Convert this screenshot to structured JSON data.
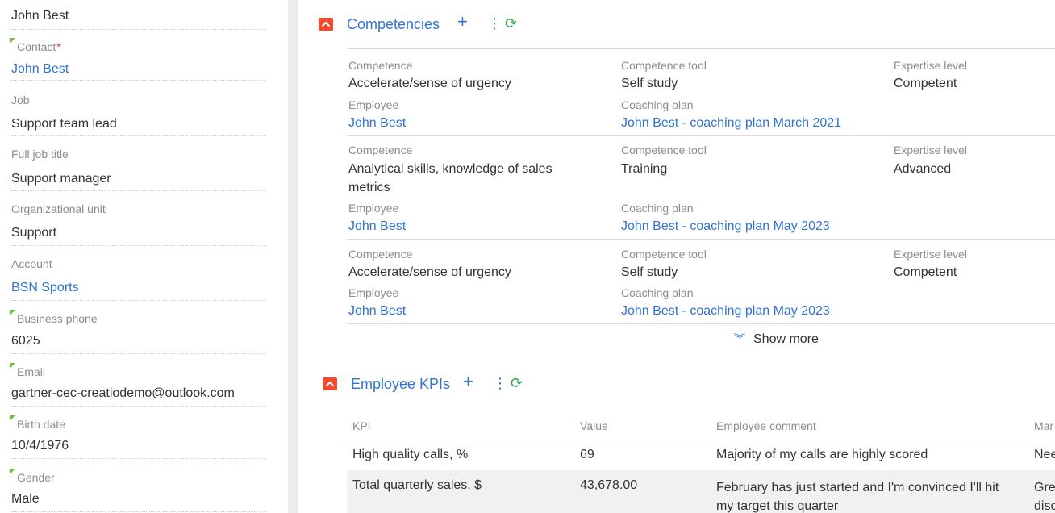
{
  "left_panel": {
    "top_value": "John Best",
    "fields": [
      {
        "label": "Contact",
        "required": "*",
        "value": "John Best",
        "link": true,
        "marker": true
      },
      {
        "label": "Job",
        "value": "Support team lead",
        "link": false,
        "marker": false
      },
      {
        "label": "Full job title",
        "value": "Support manager",
        "link": false,
        "marker": false
      },
      {
        "label": "Organizational unit",
        "value": "Support",
        "link": false,
        "marker": false
      },
      {
        "label": "Account",
        "value": "BSN Sports",
        "link": true,
        "marker": false
      },
      {
        "label": "Business phone",
        "value": "6025",
        "link": false,
        "marker": true
      },
      {
        "label": "Email",
        "value": "gartner-cec-creatiodemo@outlook.com",
        "link": false,
        "marker": true
      },
      {
        "label": "Birth date",
        "value": "10/4/1976",
        "link": false,
        "marker": true
      },
      {
        "label": "Gender",
        "value": "Male",
        "link": false,
        "marker": true
      }
    ]
  },
  "competencies": {
    "title": "Competencies",
    "labels": {
      "competence": "Competence",
      "tool": "Competence tool",
      "level": "Expertise level",
      "employee": "Employee",
      "plan": "Coaching plan"
    },
    "records": [
      {
        "competence": "Accelerate/sense of urgency",
        "tool": "Self study",
        "level": "Competent",
        "employee": "John Best",
        "plan": "John Best - coaching plan March 2021"
      },
      {
        "competence": "Analytical skills, knowledge of sales metrics",
        "tool": "Training",
        "level": "Advanced",
        "employee": "John Best",
        "plan": "John Best - coaching plan May 2023"
      },
      {
        "competence": "Accelerate/sense of urgency",
        "tool": "Self study",
        "level": "Competent",
        "employee": "John Best",
        "plan": "John Best - coaching plan May 2023"
      }
    ],
    "show_more": "Show more"
  },
  "kpis": {
    "title": "Employee KPIs",
    "columns": [
      "KPI",
      "Value",
      "Employee comment",
      "Mar"
    ],
    "rows": [
      {
        "kpi": "High quality calls, %",
        "value": "69",
        "comment": "Majority of my calls are highly scored",
        "manager": "Nee"
      },
      {
        "kpi": "Total quarterly sales, $",
        "value": "43,678.00",
        "comment": "February has just started and I'm convinced I'll hit my target this quarter",
        "manager": "Gre disc"
      }
    ]
  },
  "icons": {
    "collapse": "chevron-up-icon",
    "add": "plus-icon",
    "menu": "vertical-dots-icon",
    "refresh": "refresh-icon",
    "show_more": "double-chevron-down-icon",
    "field_marker": "green-corner-marker-icon"
  },
  "colors": {
    "link": "#2f74d0",
    "collapse_button": "#f24a2c",
    "refresh": "#35a24a",
    "marker": "#6bbf3b",
    "divider": "#ececec"
  }
}
